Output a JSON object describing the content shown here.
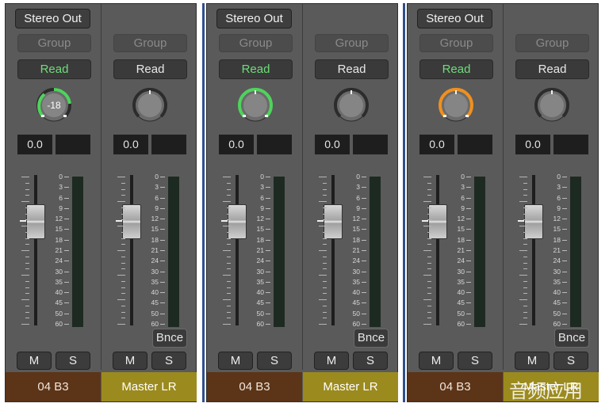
{
  "colors": {
    "panel_bg": "#5a5a5a",
    "read_green": "#6fdc7a",
    "pan_green": "#4fd35c",
    "pan_orange": "#f0901e",
    "track_color": "#5c3417",
    "master_color": "#9b8a1e",
    "meter_green": "#1d2a22"
  },
  "meter_scale": [
    "0",
    "3",
    "6",
    "9",
    "12",
    "15",
    "18",
    "21",
    "24",
    "30",
    "35",
    "40",
    "45",
    "50",
    "60"
  ],
  "panels": [
    {
      "track": {
        "output": "Stereo Out",
        "group": "Group",
        "automation": "Read",
        "pan_value": "-18",
        "pan_color": "green",
        "volume": "0.0",
        "peak": "",
        "mute": "M",
        "solo": "S",
        "name": "04 B3"
      },
      "master": {
        "group": "Group",
        "automation": "Read",
        "volume": "0.0",
        "peak": "",
        "bounce": "Bnce",
        "mute": "M",
        "solo": "S",
        "name": "Master LR"
      }
    },
    {
      "track": {
        "output": "Stereo Out",
        "group": "Group",
        "automation": "Read",
        "pan_value": "",
        "pan_color": "green",
        "volume": "0.0",
        "peak": "",
        "mute": "M",
        "solo": "S",
        "name": "04 B3"
      },
      "master": {
        "group": "Group",
        "automation": "Read",
        "volume": "0.0",
        "peak": "",
        "bounce": "Bnce",
        "mute": "M",
        "solo": "S",
        "name": "Master LR"
      }
    },
    {
      "track": {
        "output": "Stereo Out",
        "group": "Group",
        "automation": "Read",
        "pan_value": "",
        "pan_color": "orange",
        "volume": "0.0",
        "peak": "",
        "mute": "M",
        "solo": "S",
        "name": "04 B3"
      },
      "master": {
        "group": "Group",
        "automation": "Read",
        "volume": "0.0",
        "peak": "",
        "bounce": "Bnce",
        "mute": "M",
        "solo": "S",
        "name": "Master LR"
      }
    }
  ],
  "watermark": "音频应用"
}
